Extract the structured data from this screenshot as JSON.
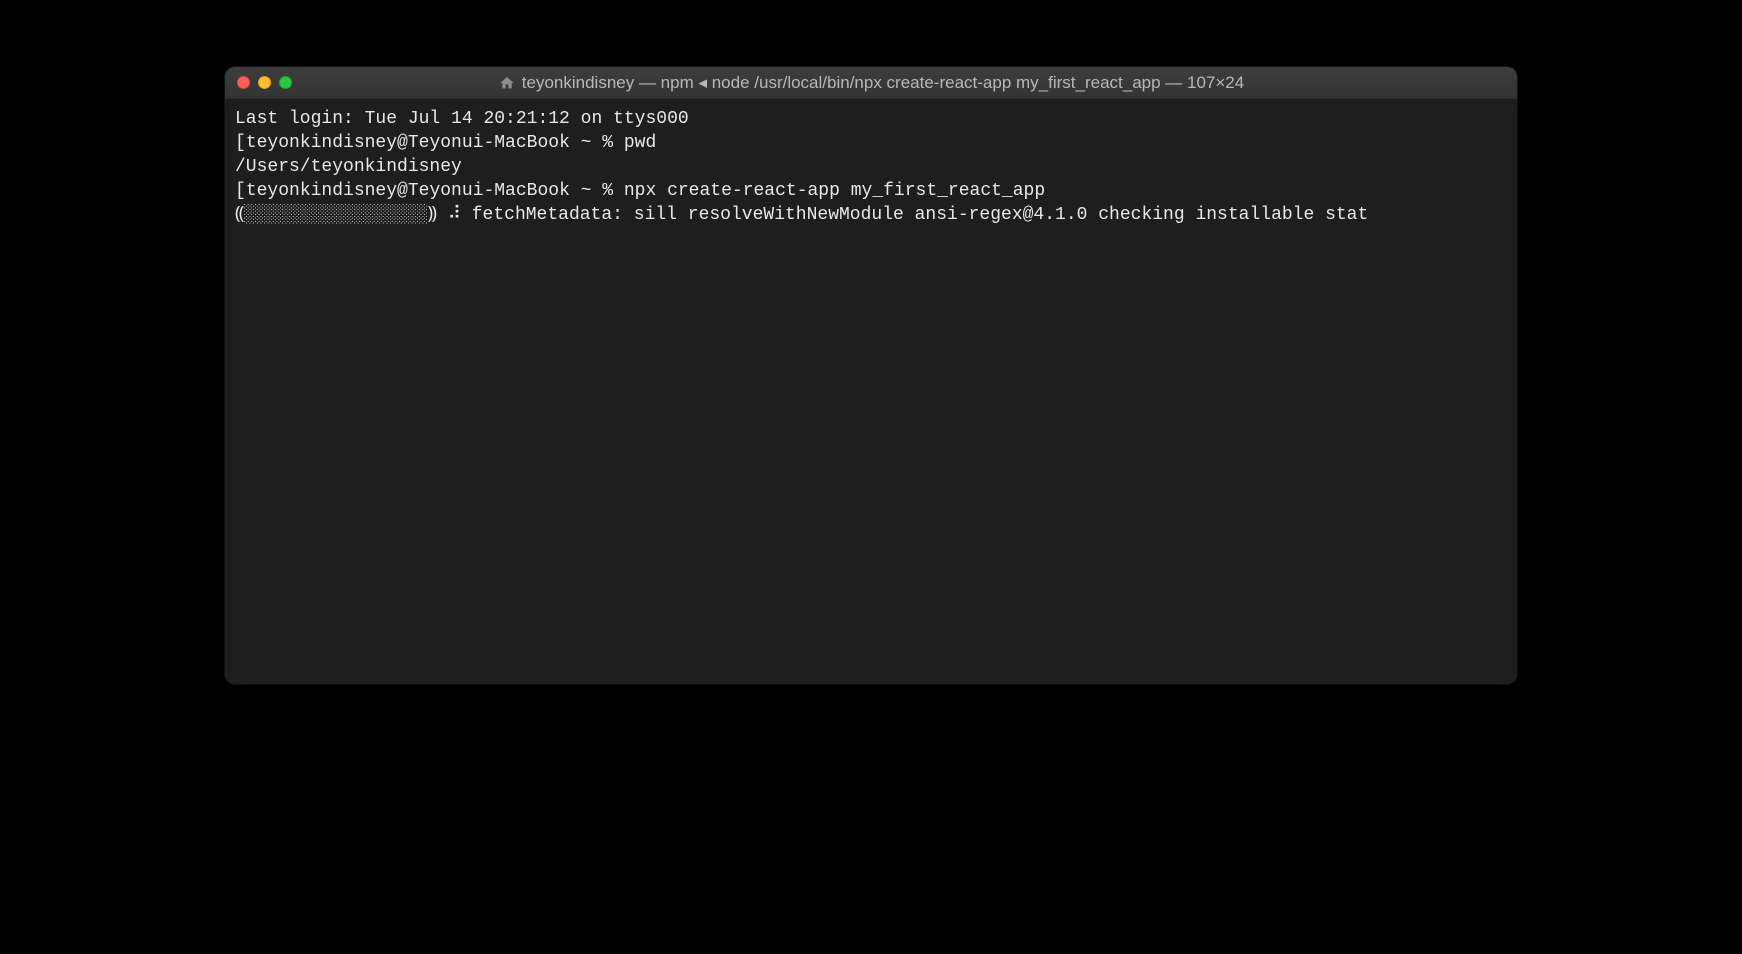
{
  "window": {
    "title": "teyonkindisney — npm ◂ node /usr/local/bin/npx create-react-app my_first_react_app — 107×24"
  },
  "terminal": {
    "lines": {
      "last_login": "Last login: Tue Jul 14 20:21:12 on ttys000",
      "prompt1_open": "[",
      "prompt1_userhost": "teyonkindisney@Teyonui-MacBook ~ % ",
      "prompt1_cmd": "pwd",
      "prompt1_close": "]",
      "pwd_output": "/Users/teyonkindisney",
      "prompt2_open": "[",
      "prompt2_userhost": "teyonkindisney@Teyonui-MacBook ~ % ",
      "prompt2_cmd": "npx create-react-app my_first_react_app",
      "prompt2_close": "]",
      "progress_open": "⸨",
      "progress_fill": " ░",
      "progress_dots": "░░░░░░░░░░░░░░░░░",
      "progress_close": "⸩ ",
      "spinner": "⠼",
      "npm_msg": " fetchMetadata: sill resolveWithNewModule ansi-regex@4.1.0 checking installable stat"
    }
  }
}
